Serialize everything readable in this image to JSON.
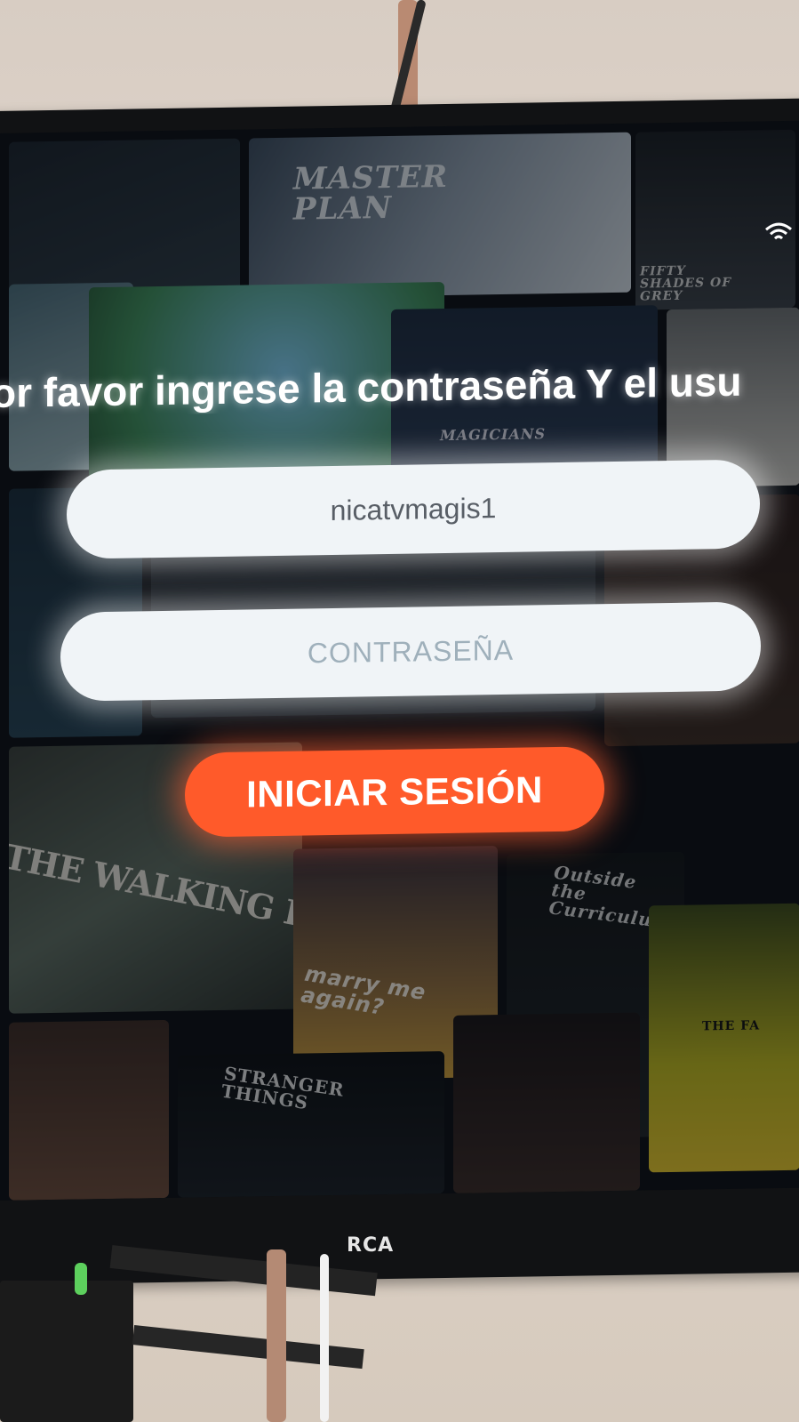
{
  "login": {
    "prompt": "or favor ingrese la contraseña Y el usu",
    "username_value": "nicatvmagis1",
    "password_placeholder": "CONTRASEÑA",
    "submit_label": "INICIAR SESIÓN"
  },
  "background_posters": [
    {
      "title": "MASTER PLAN"
    },
    {
      "title": "FIFTY SHADES OF GREY"
    },
    {
      "title": "MAGICIANS"
    },
    {
      "title": "THE WALKING DEAD"
    },
    {
      "title": "marry me again?"
    },
    {
      "title": "Outside the Curriculum"
    },
    {
      "title": "STRANGER THINGS"
    },
    {
      "title": "THE FA"
    }
  ],
  "tv": {
    "brand": "RCA"
  },
  "colors": {
    "accent": "#ff5a2a",
    "field_bg": "#f0f4f7",
    "screen_bg": "#0d0f14"
  },
  "icons": {
    "wifi": "wifi-icon"
  }
}
